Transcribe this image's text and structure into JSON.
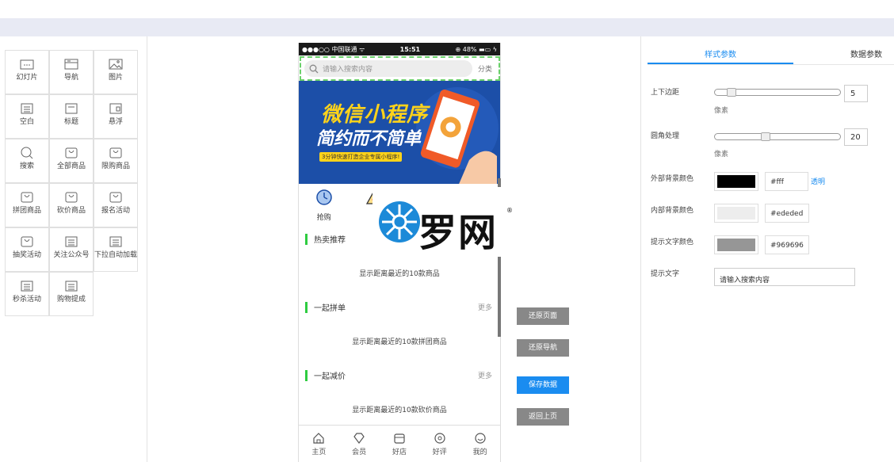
{
  "left_components": [
    {
      "label": "幻灯片",
      "icon": "slideshow-icon"
    },
    {
      "label": "导航",
      "icon": "nav-icon"
    },
    {
      "label": "图片",
      "icon": "image-icon"
    },
    {
      "label": "空白",
      "icon": "blank-icon"
    },
    {
      "label": "标题",
      "icon": "title-icon"
    },
    {
      "label": "悬浮",
      "icon": "float-icon"
    },
    {
      "label": "搜索",
      "icon": "search-icon"
    },
    {
      "label": "全部商品",
      "icon": "bag-icon"
    },
    {
      "label": "限购商品",
      "icon": "bag-icon"
    },
    {
      "label": "拼团商品",
      "icon": "bag-icon"
    },
    {
      "label": "砍价商品",
      "icon": "bag-icon"
    },
    {
      "label": "报名活动",
      "icon": "bag-icon"
    },
    {
      "label": "抽奖活动",
      "icon": "bag-icon"
    },
    {
      "label": "关注公众号",
      "icon": "list-icon"
    },
    {
      "label": "下拉自动加载",
      "icon": "list-icon"
    },
    {
      "label": "秒杀活动",
      "icon": "list-icon"
    },
    {
      "label": "购物提成",
      "icon": "list-icon"
    }
  ],
  "phone": {
    "status": {
      "carrier": "●●●○○ 中国联通 ᯤ",
      "time": "15:51",
      "battery": "⊕ 48% ▬▭ ϟ"
    },
    "search_placeholder": "请输入搜索内容",
    "search_category": "分类",
    "banner": {
      "line1": "微信小程序",
      "line2": "简约而不简单",
      "line3": "3分钟快速打造企业专属小程序!"
    },
    "icons": [
      {
        "label": "抢购"
      },
      {
        "label": ""
      },
      {
        "label": ""
      },
      {
        "label": ""
      }
    ],
    "sections": [
      {
        "title": "热卖推荐",
        "more": "",
        "info": "显示距离最近的10款商品"
      },
      {
        "title": "一起拼单",
        "more": "更多",
        "info": "显示距离最近的10款拼团商品"
      },
      {
        "title": "一起减价",
        "more": "更多",
        "info": "显示距离最近的10款砍价商品"
      }
    ],
    "tabs": [
      "主页",
      "会员",
      "好店",
      "好评",
      "我的"
    ]
  },
  "watermark": {
    "text": "罗网",
    "reg": "®"
  },
  "buttons": {
    "restore_page": "还原页面",
    "restore_nav": "还原导航",
    "save": "保存数据",
    "back": "返回上页"
  },
  "right": {
    "tab_style": "样式参数",
    "tab_data": "数据参数",
    "margin_label": "上下边距",
    "margin_value": "5",
    "margin_unit": "像素",
    "margin_fraction": 0.1,
    "radius_label": "圆角处理",
    "radius_value": "20",
    "radius_unit": "像素",
    "radius_fraction": 0.4,
    "outer_bg_label": "外部背景颜色",
    "outer_bg_hex": "#fff",
    "outer_bg_swatch": "#000000",
    "transparent_label": "透明",
    "inner_bg_label": "内部背景颜色",
    "inner_bg_hex": "#ededed",
    "inner_bg_swatch": "#ededed",
    "hint_color_label": "提示文字颜色",
    "hint_color_hex": "#969696",
    "hint_color_swatch": "#969696",
    "hint_text_label": "提示文字",
    "hint_text_value": "请输入搜索内容"
  },
  "colors": {
    "accent": "#1a8cf0",
    "section_bar": "#2ecc40",
    "banner_bg": "#1c4fa8"
  }
}
